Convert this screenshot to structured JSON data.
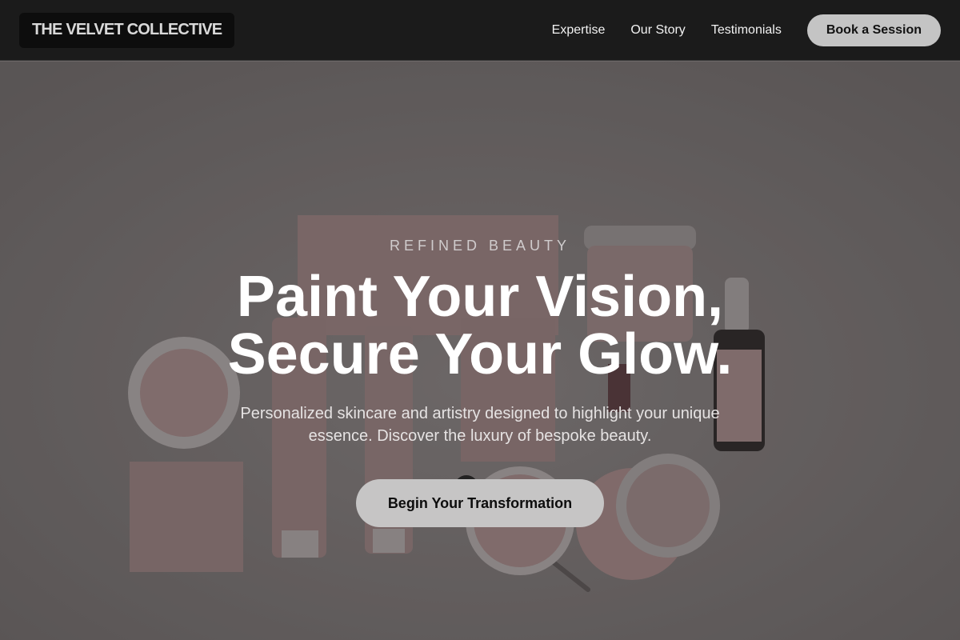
{
  "nav": {
    "brand": "THE VELVET COLLECTIVE",
    "links": [
      "Expertise",
      "Our Story",
      "Testimonials"
    ],
    "cta_label": "Book a Session"
  },
  "hero": {
    "eyebrow": "REFINED BEAUTY",
    "headline_line1": "Paint Your Vision,",
    "headline_line2": "Secure Your Glow.",
    "subtext": "Personalized skincare and artistry designed to highlight your unique essence. Discover the luxury of bespoke beauty.",
    "cta_label": "Begin Your Transformation",
    "background_image": "cosmetic-products-flatlay"
  },
  "colors": {
    "nav_bg": "#1b1b1b",
    "button_bg": "#c4c4c4",
    "hero_tint": "#6d6868",
    "product_pink": "#c9a3a0"
  }
}
